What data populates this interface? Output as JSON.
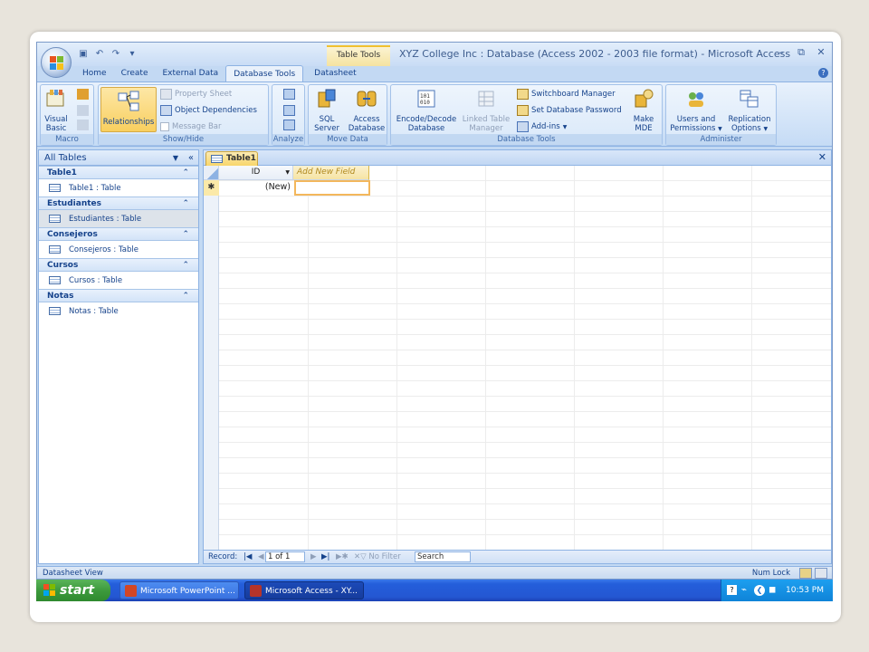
{
  "window": {
    "title": "XYZ College Inc : Database (Access 2002 - 2003 file format) - Microsoft Access",
    "context_tab": "Table Tools"
  },
  "tabs": [
    "Home",
    "Create",
    "External Data",
    "Database Tools",
    "Datasheet"
  ],
  "active_tab": "Database Tools",
  "ribbon": {
    "macro": {
      "visual_basic": "Visual\nBasic",
      "label": "Macro"
    },
    "show_hide": {
      "relationships": "Relationships",
      "property_sheet": "Property Sheet",
      "object_dependencies": "Object Dependencies",
      "message_bar": "Message Bar",
      "label": "Show/Hide"
    },
    "analyze": {
      "label": "Analyze"
    },
    "move_data": {
      "sql_server_1": "SQL",
      "sql_server_2": "Server",
      "access_db_1": "Access",
      "access_db_2": "Database",
      "label": "Move Data"
    },
    "database_tools": {
      "encode_1": "Encode/Decode",
      "encode_2": "Database",
      "linked_1": "Linked Table",
      "linked_2": "Manager",
      "switchboard": "Switchboard Manager",
      "set_password": "Set Database Password",
      "addins": "Add-ins",
      "make_mde_1": "Make",
      "make_mde_2": "MDE",
      "label": "Database Tools"
    },
    "administer": {
      "users_1": "Users and",
      "users_2": "Permissions",
      "replication_1": "Replication",
      "replication_2": "Options",
      "label": "Administer"
    }
  },
  "nav": {
    "header": "All Tables",
    "groups": [
      {
        "name": "Table1",
        "item": "Table1 : Table"
      },
      {
        "name": "Estudiantes",
        "item": "Estudiantes : Table"
      },
      {
        "name": "Consejeros",
        "item": "Consejeros : Table"
      },
      {
        "name": "Cursos",
        "item": "Cursos : Table"
      },
      {
        "name": "Notas",
        "item": "Notas : Table"
      }
    ]
  },
  "document": {
    "tab": "Table1",
    "columns": {
      "id": "ID",
      "add_new": "Add New Field"
    },
    "new_row": "(New)",
    "record_nav": {
      "label": "Record:",
      "position": "1 of 1",
      "filter": "No Filter",
      "search": "Search"
    }
  },
  "status": {
    "left": "Datasheet View",
    "right": "Num Lock"
  },
  "taskbar": {
    "start": "start",
    "items": [
      "Microsoft PowerPoint ...",
      "Microsoft Access - XY..."
    ],
    "clock": "10:53 PM"
  },
  "colors": {
    "accent": "#15428b",
    "active_tab": "#f8d66b",
    "taskbar": "#245edb",
    "start": "#3d9a3d"
  }
}
